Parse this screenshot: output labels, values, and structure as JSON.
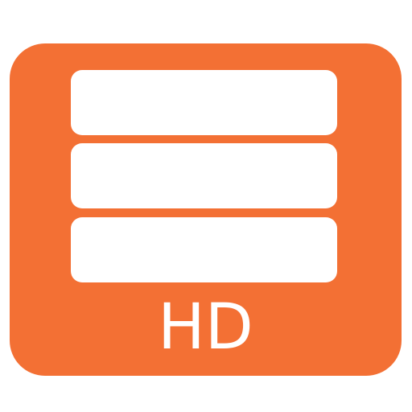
{
  "icon": {
    "label": "HD",
    "colors": {
      "background": "#F37034",
      "foreground": "#FFFFFF"
    },
    "icon_name": "stacked-drives-icon"
  }
}
